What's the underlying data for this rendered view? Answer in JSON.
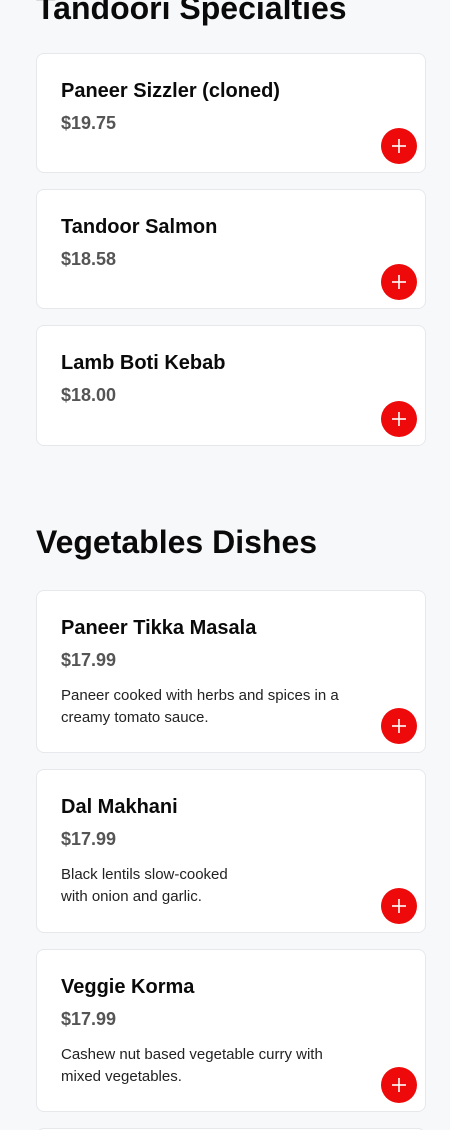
{
  "sections": [
    {
      "title": "Tandoori Specialties",
      "items": [
        {
          "name": "Paneer Sizzler (cloned)",
          "price": "$19.75",
          "description": ""
        },
        {
          "name": "Tandoor Salmon",
          "price": "$18.58",
          "description": ""
        },
        {
          "name": "Lamb Boti Kebab",
          "price": "$18.00",
          "description": ""
        }
      ]
    },
    {
      "title": "Vegetables Dishes",
      "items": [
        {
          "name": "Paneer Tikka Masala",
          "price": "$17.99",
          "description": "Paneer cooked with herbs and spices in a creamy tomato sauce."
        },
        {
          "name": "Dal Makhani",
          "price": "$17.99",
          "description": "Black lentils slow-cooked with onion and garlic."
        },
        {
          "name": "Veggie Korma",
          "price": "$17.99",
          "description": "Cashew nut based vegetable curry with mixed vegetables."
        }
      ]
    }
  ],
  "colors": {
    "accent": "#ee0a0a",
    "background": "#f7f8fa",
    "card": "#ffffff",
    "price": "#555555"
  },
  "icons": {
    "add": "plus-icon"
  }
}
